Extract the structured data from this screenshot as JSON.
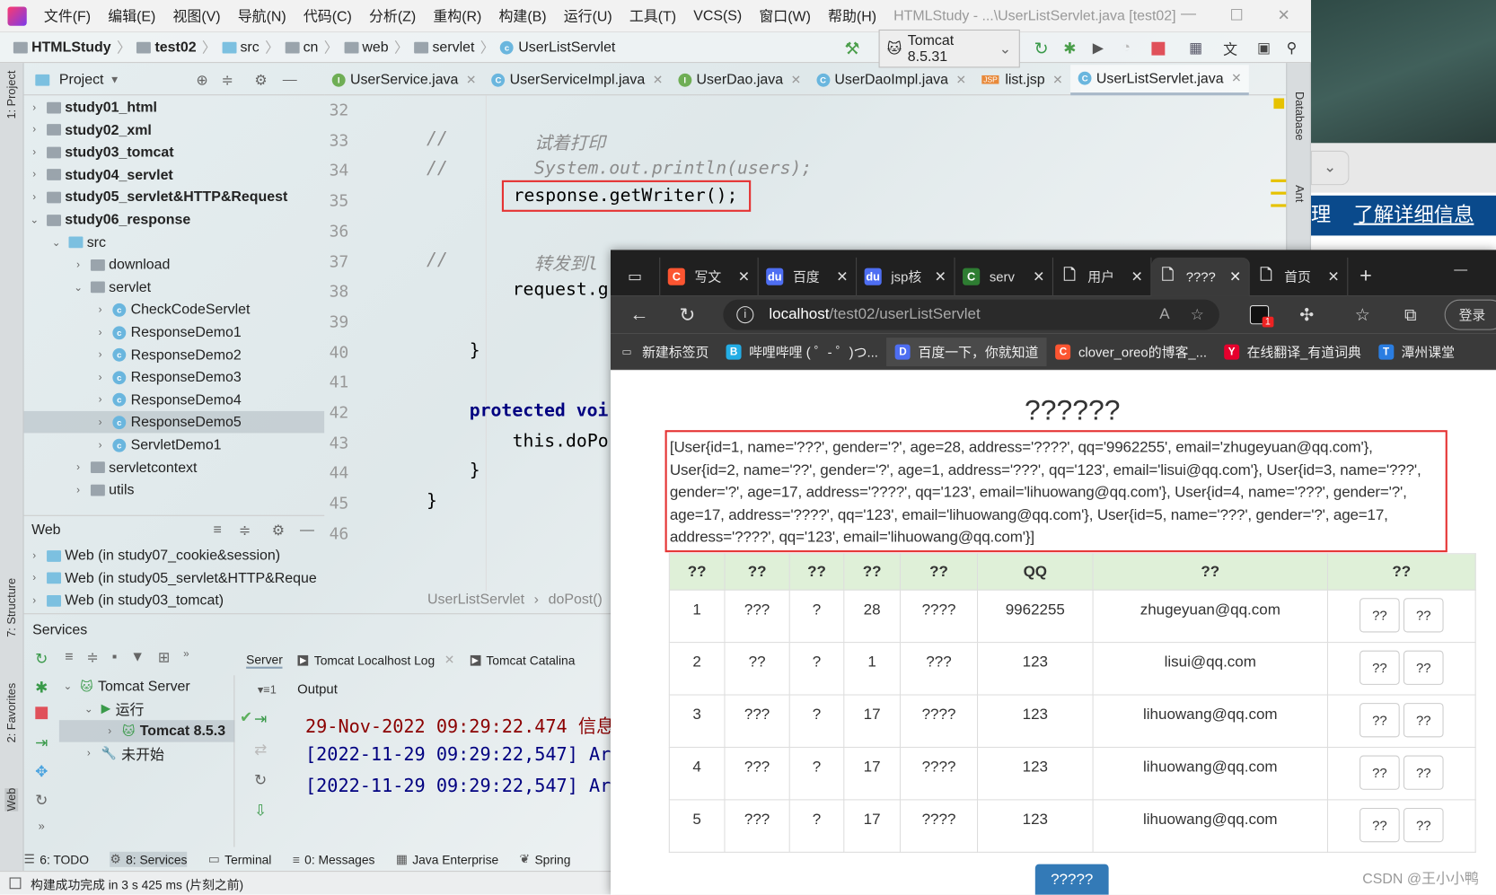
{
  "ide": {
    "menu": [
      "文件(F)",
      "编辑(E)",
      "视图(V)",
      "导航(N)",
      "代码(C)",
      "分析(Z)",
      "重构(R)",
      "构建(B)",
      "运行(U)",
      "工具(T)",
      "VCS(S)",
      "窗口(W)",
      "帮助(H)"
    ],
    "window_title": "HTMLStudy - ...\\UserListServlet.java [test02]",
    "breadcrumb": [
      "HTMLStudy",
      "test02",
      "src",
      "cn",
      "web",
      "servlet",
      "UserListServlet"
    ],
    "run_config": "Tomcat 8.5.31",
    "left_strip": [
      "1: Project",
      "7: Structure",
      "2: Favorites",
      "Web"
    ],
    "right_strip": [
      "Database",
      "Ant"
    ],
    "project": {
      "title": "Project",
      "items": [
        {
          "label": "study01_html",
          "bold": true,
          "level": 0,
          "exp": ">"
        },
        {
          "label": "study02_xml",
          "bold": true,
          "level": 0,
          "exp": ">"
        },
        {
          "label": "study03_tomcat",
          "bold": true,
          "level": 0,
          "exp": ">"
        },
        {
          "label": "study04_servlet",
          "bold": true,
          "level": 0,
          "exp": ">"
        },
        {
          "label": "study05_servlet&HTTP&Request",
          "bold": true,
          "level": 0,
          "exp": ">"
        },
        {
          "label": "study06_response",
          "bold": true,
          "level": 0,
          "exp": "v"
        },
        {
          "label": "src",
          "level": 1,
          "exp": "v",
          "icon": "folder-blue"
        },
        {
          "label": "download",
          "level": 2,
          "exp": ">"
        },
        {
          "label": "servlet",
          "level": 2,
          "exp": "v"
        },
        {
          "label": "CheckCodeServlet",
          "level": 3,
          "exp": ">",
          "icon": "class"
        },
        {
          "label": "ResponseDemo1",
          "level": 3,
          "exp": ">",
          "icon": "class"
        },
        {
          "label": "ResponseDemo2",
          "level": 3,
          "exp": ">",
          "icon": "class"
        },
        {
          "label": "ResponseDemo3",
          "level": 3,
          "exp": ">",
          "icon": "class"
        },
        {
          "label": "ResponseDemo4",
          "level": 3,
          "exp": ">",
          "icon": "class"
        },
        {
          "label": "ResponseDemo5",
          "level": 3,
          "exp": ">",
          "icon": "class",
          "selected": true
        },
        {
          "label": "ServletDemo1",
          "level": 3,
          "exp": ">",
          "icon": "class"
        },
        {
          "label": "servletcontext",
          "level": 2,
          "exp": ">"
        },
        {
          "label": "utils",
          "level": 2,
          "exp": ">"
        }
      ]
    },
    "web": {
      "title": "Web",
      "items": [
        "Web (in study07_cookie&session)",
        "Web (in study05_servlet&HTTP&Reque",
        "Web (in study03_tomcat)"
      ]
    },
    "editor_tabs": [
      {
        "label": "UserService.java",
        "icon": "I"
      },
      {
        "label": "UserServiceImpl.java",
        "icon": "C"
      },
      {
        "label": "UserDao.java",
        "icon": "I"
      },
      {
        "label": "UserDaoImpl.java",
        "icon": "C"
      },
      {
        "label": "list.jsp",
        "icon": "JSP"
      },
      {
        "label": "UserListServlet.java",
        "icon": "C",
        "active": true
      }
    ],
    "code": [
      {
        "n": "32"
      },
      {
        "n": "33",
        "pre": "//",
        "text": "试着打印",
        "cls": "cm"
      },
      {
        "n": "34",
        "pre": "//",
        "text": "System.out.println(users);",
        "cls": "cm"
      },
      {
        "n": "35",
        "text": "response.getWriter();",
        "box": true
      },
      {
        "n": "36"
      },
      {
        "n": "37",
        "pre": "//",
        "text": "转发到l",
        "cls": "cm"
      },
      {
        "n": "38",
        "text": "request.g"
      },
      {
        "n": "39"
      },
      {
        "n": "40",
        "text": "}",
        "ind": 1
      },
      {
        "n": "41"
      },
      {
        "n": "42",
        "text": "protected voi",
        "ind": 1,
        "cls": "kw"
      },
      {
        "n": "43",
        "text": "this.doPo"
      },
      {
        "n": "44",
        "text": "}",
        "ind": 1
      },
      {
        "n": "45",
        "text": "}",
        "ind": 0
      },
      {
        "n": "46"
      }
    ],
    "editor_breadcrumb": [
      "UserListServlet",
      "doPost()"
    ],
    "services": {
      "title": "Services",
      "tabs": [
        "Server",
        "Tomcat Localhost Log",
        "Tomcat Catalina"
      ],
      "output_label": "Output",
      "tree": [
        "Tomcat Server",
        "运行",
        "Tomcat 8.5.3",
        "未开始"
      ],
      "log": [
        "29-Nov-2022 09:29:22.474 信息",
        "[2022-11-29 09:29:22,547] Ar",
        "[2022-11-29 09:29:22,547] Ar"
      ]
    },
    "bottom_tabs": [
      "6: TODO",
      "8: Services",
      "Terminal",
      "0: Messages",
      "Java Enterprise",
      "Spring"
    ],
    "status": "构建成功完成 in 3 s 425 ms (片刻之前)"
  },
  "desktop": {
    "link": "了解详细信息",
    "partial": "理"
  },
  "browser": {
    "tabs": [
      {
        "label": "写文",
        "fav": "C",
        "color": "#fc5531"
      },
      {
        "label": "百度",
        "fav": "du",
        "color": "#4e6ef2"
      },
      {
        "label": "jsp核",
        "fav": "du",
        "color": "#4e6ef2"
      },
      {
        "label": "serv",
        "fav": "C",
        "color": "#2e7d32"
      },
      {
        "label": "用户",
        "fav": "doc"
      },
      {
        "label": "????",
        "fav": "doc",
        "active": true
      },
      {
        "label": "首页",
        "fav": "doc"
      }
    ],
    "url_host": "localhost",
    "url_path": "/test02/userListServlet",
    "login": "登录",
    "ext_badge": "1",
    "bookmarks": [
      {
        "label": "新建标签页",
        "icon": "tab"
      },
      {
        "label": "哔哩哔哩 ( ゜- ゜)つ...",
        "icon": "bili",
        "color": "#23ade5"
      },
      {
        "label": "百度一下，你就知道",
        "icon": "du",
        "color": "#4e6ef2"
      },
      {
        "label": "clover_oreo的博客_...",
        "icon": "C",
        "color": "#fc5531"
      },
      {
        "label": "在线翻译_有道词典",
        "icon": "y",
        "color": "#e6002d"
      },
      {
        "label": "潭州课堂",
        "icon": "tz",
        "color": "#2a7de1"
      }
    ],
    "page": {
      "heading": "??????",
      "dump": "[User{id=1, name='???', gender='?', age=28, address='????', qq='9962255', email='zhugeyuan@qq.com'}, User{id=2, name='??', gender='?', age=1, address='???', qq='123', email='lisui@qq.com'}, User{id=3, name='???', gender='?', age=17, address='????', qq='123', email='lihuowang@qq.com'}, User{id=4, name='???', gender='?', age=17, address='????', qq='123', email='lihuowang@qq.com'}, User{id=5, name='???', gender='?', age=17, address='????', qq='123', email='lihuowang@qq.com'}]",
      "headers": [
        "??",
        "??",
        "??",
        "??",
        "??",
        "QQ",
        "??",
        "??"
      ],
      "rows": [
        [
          "1",
          "???",
          "?",
          "28",
          "????",
          "9962255",
          "zhugeyuan@qq.com"
        ],
        [
          "2",
          "??",
          "?",
          "1",
          "???",
          "123",
          "lisui@qq.com"
        ],
        [
          "3",
          "???",
          "?",
          "17",
          "????",
          "123",
          "lihuowang@qq.com"
        ],
        [
          "4",
          "???",
          "?",
          "17",
          "????",
          "123",
          "lihuowang@qq.com"
        ],
        [
          "5",
          "???",
          "?",
          "17",
          "????",
          "123",
          "lihuowang@qq.com"
        ]
      ],
      "row_buttons": [
        "??",
        "??"
      ],
      "add_button": "?????"
    }
  },
  "watermark": "CSDN @王小小鸭",
  "colors": {
    "highlight_box": "#e53333",
    "table_header": "#dff0d8",
    "primary_button": "#337ab7",
    "log_red": "#8b0000",
    "log_blue": "#000080"
  }
}
